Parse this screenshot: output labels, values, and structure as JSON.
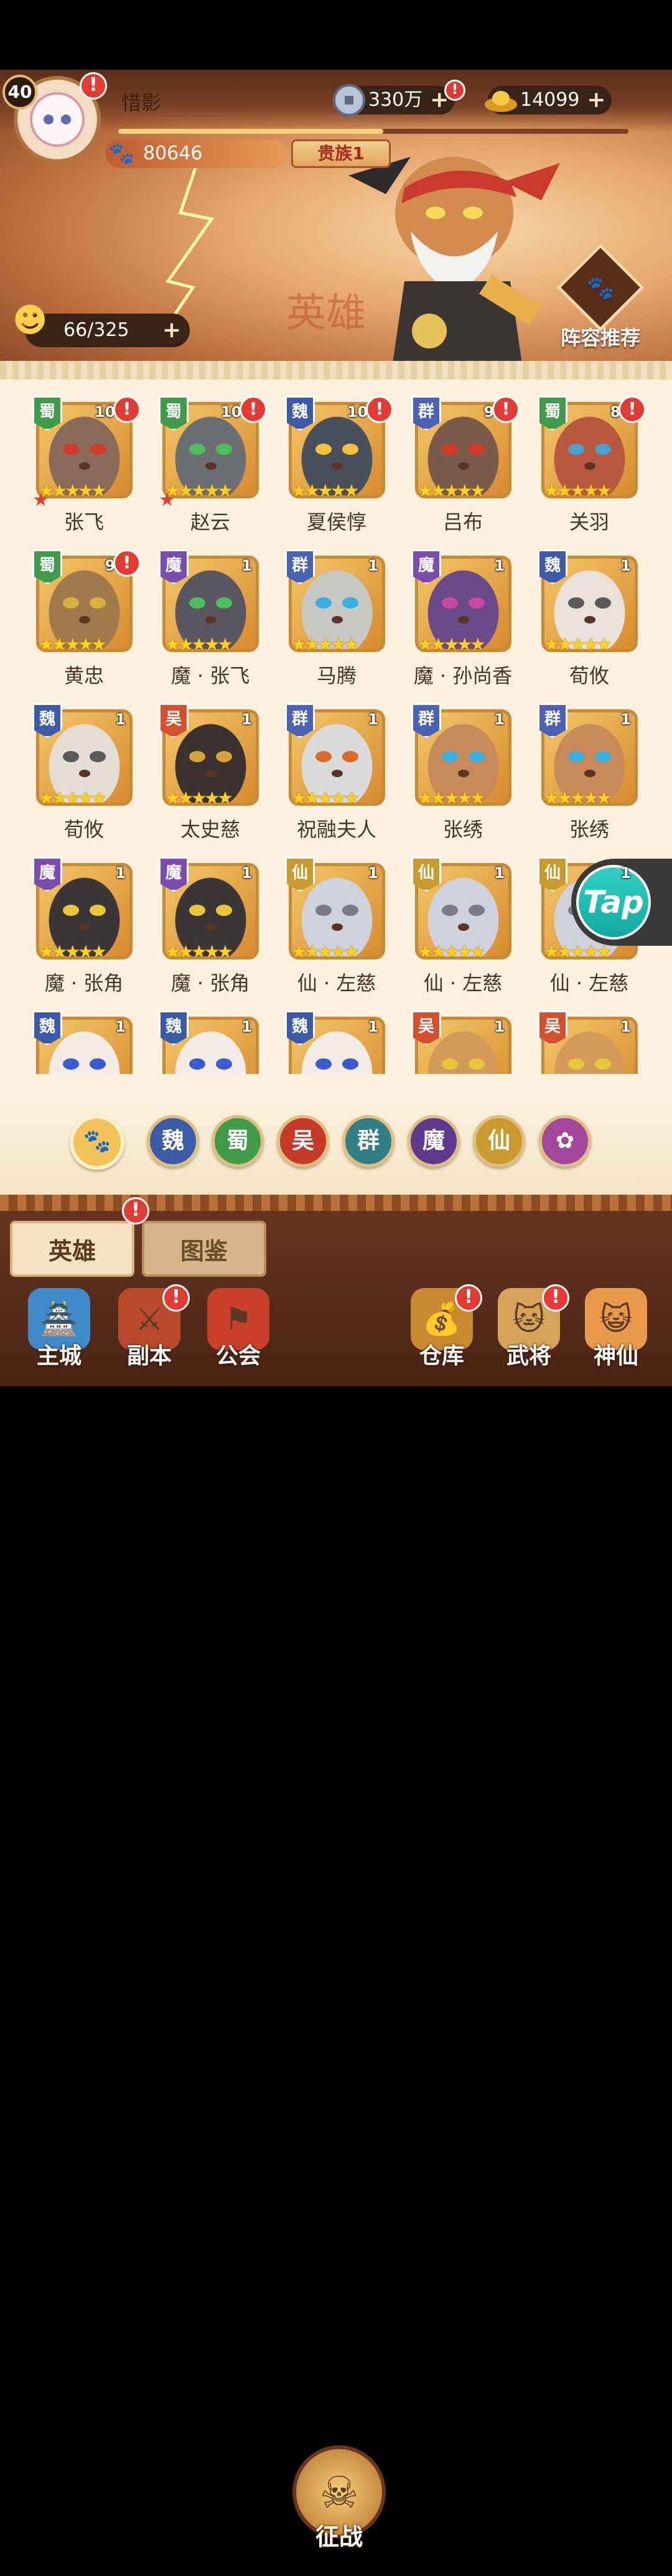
{
  "player": {
    "level": "40",
    "name": "惜影",
    "power": "80646",
    "noble": "贵族1",
    "exp_progress": 0.52
  },
  "resources": {
    "coins": "330万",
    "ingots": "14099",
    "stamina": "66/325"
  },
  "banner": {
    "calligraphy": "英雄",
    "formation_label": "阵容推荐"
  },
  "heroes": [
    {
      "name": "张飞",
      "faction": "蜀",
      "level": "100",
      "alert": true,
      "red_star": true
    },
    {
      "name": "赵云",
      "faction": "蜀",
      "level": "100",
      "alert": true,
      "red_star": true
    },
    {
      "name": "夏侯惇",
      "faction": "魏",
      "level": "100",
      "alert": true,
      "red_star": false
    },
    {
      "name": "吕布",
      "faction": "群",
      "level": "96",
      "alert": true,
      "red_star": false
    },
    {
      "name": "关羽",
      "faction": "蜀",
      "level": "80",
      "alert": true,
      "red_star": false
    },
    {
      "name": "黄忠",
      "faction": "蜀",
      "level": "92",
      "alert": true,
      "red_star": false
    },
    {
      "name": "魔 · 张飞",
      "faction": "魔",
      "level": "1",
      "alert": false,
      "red_star": false
    },
    {
      "name": "马腾",
      "faction": "群",
      "level": "1",
      "alert": false,
      "red_star": false
    },
    {
      "name": "魔 · 孙尚香",
      "faction": "魔",
      "level": "1",
      "alert": false,
      "red_star": false
    },
    {
      "name": "荀攸",
      "faction": "魏",
      "level": "1",
      "alert": false,
      "red_star": false
    },
    {
      "name": "荀攸",
      "faction": "魏",
      "level": "1",
      "alert": false,
      "red_star": false
    },
    {
      "name": "太史慈",
      "faction": "吴",
      "level": "1",
      "alert": false,
      "red_star": false
    },
    {
      "name": "祝融夫人",
      "faction": "群",
      "level": "1",
      "alert": false,
      "red_star": false
    },
    {
      "name": "张绣",
      "faction": "群",
      "level": "1",
      "alert": false,
      "red_star": false
    },
    {
      "name": "张绣",
      "faction": "群",
      "level": "1",
      "alert": false,
      "red_star": false
    },
    {
      "name": "魔 · 张角",
      "faction": "魔",
      "level": "1",
      "alert": false,
      "red_star": false
    },
    {
      "name": "魔 · 张角",
      "faction": "魔",
      "level": "1",
      "alert": false,
      "red_star": false
    },
    {
      "name": "仙 · 左慈",
      "faction": "仙",
      "level": "1",
      "alert": false,
      "red_star": false
    },
    {
      "name": "仙 · 左慈",
      "faction": "仙",
      "level": "1",
      "alert": false,
      "red_star": false
    },
    {
      "name": "仙 · 左慈",
      "faction": "仙",
      "level": "1",
      "alert": false,
      "red_star": false
    },
    {
      "name": "",
      "faction": "魏",
      "level": "1",
      "alert": false,
      "red_star": false
    },
    {
      "name": "",
      "faction": "魏",
      "level": "1",
      "alert": false,
      "red_star": false
    },
    {
      "name": "",
      "faction": "魏",
      "level": "1",
      "alert": false,
      "red_star": false
    },
    {
      "name": "",
      "faction": "吴",
      "level": "1",
      "alert": false,
      "red_star": false
    },
    {
      "name": "",
      "faction": "吴",
      "level": "1",
      "alert": false,
      "red_star": false
    }
  ],
  "faction_colors": {
    "蜀": "#3f9a4a",
    "魏": "#3b5aa8",
    "群": "#4a62b6",
    "魔": "#7a4cb0",
    "吴": "#d6502f",
    "仙": "#c99a2e"
  },
  "filters": [
    {
      "label": "🐾",
      "color": "#f3c35a",
      "icon": "paw-icon"
    },
    {
      "label": "魏",
      "color": "#3b5aa8"
    },
    {
      "label": "蜀",
      "color": "#3f9a4a"
    },
    {
      "label": "吴",
      "color": "#c63a2a"
    },
    {
      "label": "群",
      "color": "#2f7f84"
    },
    {
      "label": "魔",
      "color": "#5e3a8e"
    },
    {
      "label": "仙",
      "color": "#c99a2e"
    },
    {
      "label": "✿",
      "color": "#a2479a",
      "icon": "swirl-icon"
    }
  ],
  "tabs": {
    "heroes": "英雄",
    "codex": "图鉴"
  },
  "nav": {
    "city": "主城",
    "dungeon": "副本",
    "guild": "公会",
    "battle": "征战",
    "warehouse": "仓库",
    "general": "武将",
    "immortal": "神仙"
  },
  "overlay": {
    "tap": "Tap"
  }
}
